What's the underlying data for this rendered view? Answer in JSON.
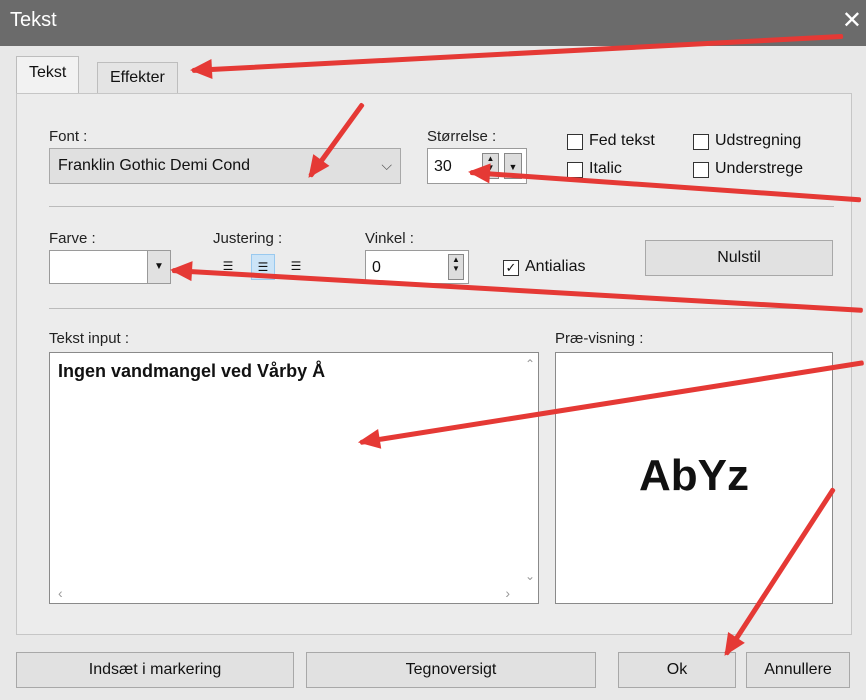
{
  "window": {
    "title": "Tekst",
    "close_label": "✕"
  },
  "tabs": [
    {
      "label": "Tekst"
    },
    {
      "label": "Effekter"
    }
  ],
  "font": {
    "label": "Font :",
    "value": "Franklin Gothic Demi Cond"
  },
  "size": {
    "label": "Størrelse :",
    "value": "30"
  },
  "checkboxes": {
    "bold": {
      "label": "Fed tekst",
      "checked": false
    },
    "italic": {
      "label": "Italic",
      "checked": false
    },
    "strike": {
      "label": "Udstregning",
      "checked": false
    },
    "underline": {
      "label": "Understrege",
      "checked": false
    }
  },
  "color": {
    "label": "Farve :",
    "value": ""
  },
  "justify": {
    "label": "Justering :",
    "selected": "center"
  },
  "angle": {
    "label": "Vinkel :",
    "value": "0"
  },
  "antialias": {
    "label": "Antialias",
    "checked": true
  },
  "reset_button": "Nulstil",
  "text_input": {
    "label": "Tekst input :",
    "value": "Ingen vandmangel ved Vårby Å"
  },
  "preview": {
    "label": "Præ-visning :",
    "sample": "AbYz"
  },
  "footer": {
    "insert_label": "Indsæt i markering",
    "charmap_label": "Tegnoversigt",
    "ok_label": "Ok",
    "cancel_label": "Annullere"
  },
  "colors": {
    "titlebar": "#6b6b6b",
    "arrow": "#e53935",
    "selected_align": "#cce4f7"
  }
}
